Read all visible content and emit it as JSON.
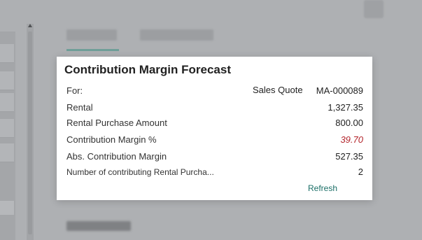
{
  "dialog": {
    "title": "Contribution Margin Forecast",
    "for": {
      "label": "For:",
      "type": "Sales Quote",
      "number": "MA-000089"
    },
    "rows": [
      {
        "label": "Rental",
        "value": "1,327.35"
      },
      {
        "label": "Rental Purchase Amount",
        "value": "800.00"
      },
      {
        "label": "Contribution Margin %",
        "value": "39.70"
      },
      {
        "label": "Abs. Contribution Margin",
        "value": "527.35"
      },
      {
        "label": "Number of contributing Rental Purcha...",
        "value": "2"
      }
    ],
    "refresh_label": "Refresh"
  },
  "colors": {
    "accent": "#1b6f67",
    "negative_value": "#b3242b",
    "overlay_background": "#aeb0b3"
  }
}
